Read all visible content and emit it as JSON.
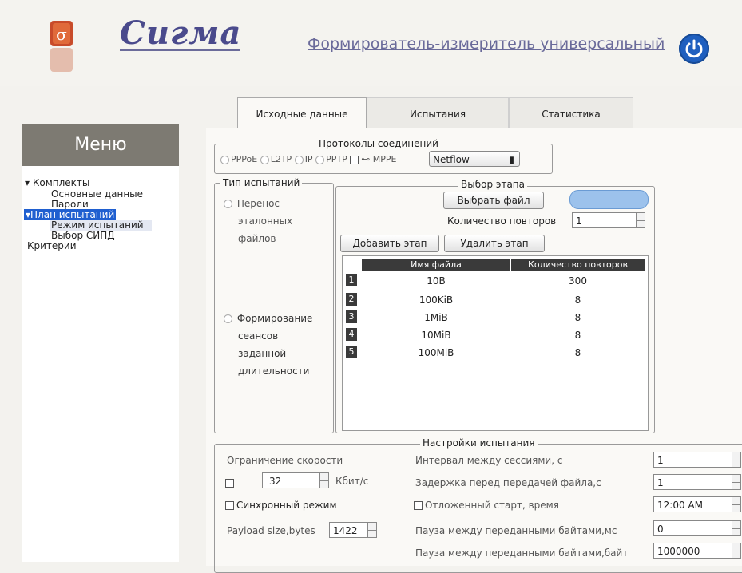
{
  "header": {
    "logo_text": "Сигма",
    "app_title": "Формирователь-измеритель универсальный"
  },
  "sidebar": {
    "title": "Меню",
    "items": [
      {
        "label": "Комплекты"
      },
      {
        "label": "Основные данные"
      },
      {
        "label": "Пароли"
      },
      {
        "label": "План испытаний"
      },
      {
        "label": "Режим испытаний"
      },
      {
        "label": "Выбор СИПД"
      },
      {
        "label": "Критерии"
      }
    ]
  },
  "tabs": [
    {
      "label": "Исходные данные",
      "active": true
    },
    {
      "label": "Испытания",
      "active": false
    },
    {
      "label": "Статистика",
      "active": false
    }
  ],
  "protocols": {
    "legend": "Протоколы соединений",
    "options": [
      "PPPoE",
      "L2TP",
      "IP",
      "PPTP",
      "MPPE"
    ],
    "select_value": "Netflow"
  },
  "test_type": {
    "legend": "Тип испытаний",
    "option1_lines": [
      "Перенос",
      "эталонных",
      "файлов"
    ],
    "option2_lines": [
      "Формирование",
      "сеансов",
      "заданной",
      "длительности"
    ]
  },
  "stage": {
    "legend": "Выбор этапа",
    "choose_file_label": "Выбрать файл",
    "repeat_label": "Количество повторов",
    "repeat_value": "1",
    "add_stage_label": "Добавить этап",
    "delete_stage_label": "Удалить этап",
    "table": {
      "columns": [
        "Имя файла",
        "Количество повторов"
      ],
      "rows": [
        {
          "num": "1",
          "file": "10B",
          "count": "300"
        },
        {
          "num": "2",
          "file": "100KiB",
          "count": "8"
        },
        {
          "num": "3",
          "file": "1MiB",
          "count": "8"
        },
        {
          "num": "4",
          "file": "10MiB",
          "count": "8"
        },
        {
          "num": "5",
          "file": "100MiB",
          "count": "8"
        }
      ]
    }
  },
  "settings": {
    "legend": "Настройки испытания",
    "speed_limit_label": "Ограничение скорости",
    "speed_value": "32",
    "speed_unit": "Кбит/с",
    "sync_mode_label": "Синхронный режим",
    "payload_label": "Payload size,bytes",
    "payload_value": "1422",
    "interval_label": "Интервал между сессиями, с",
    "interval_value": "1",
    "delay_label": "Задержка перед передачей файла,с",
    "delay_value": "1",
    "delayed_start_label": "Отложенный старт, время",
    "delayed_start_value": "12:00 AM",
    "pause_ms_label": "Пауза между переданными байтами,мс",
    "pause_ms_value": "0",
    "pause_bytes_label": "Пауза между переданными байтами,байт",
    "pause_bytes_value": "1000000"
  },
  "colors": {
    "accent": "#1f5fd0",
    "menu_header": "#7d7a72",
    "power": "#1f5fbf"
  }
}
